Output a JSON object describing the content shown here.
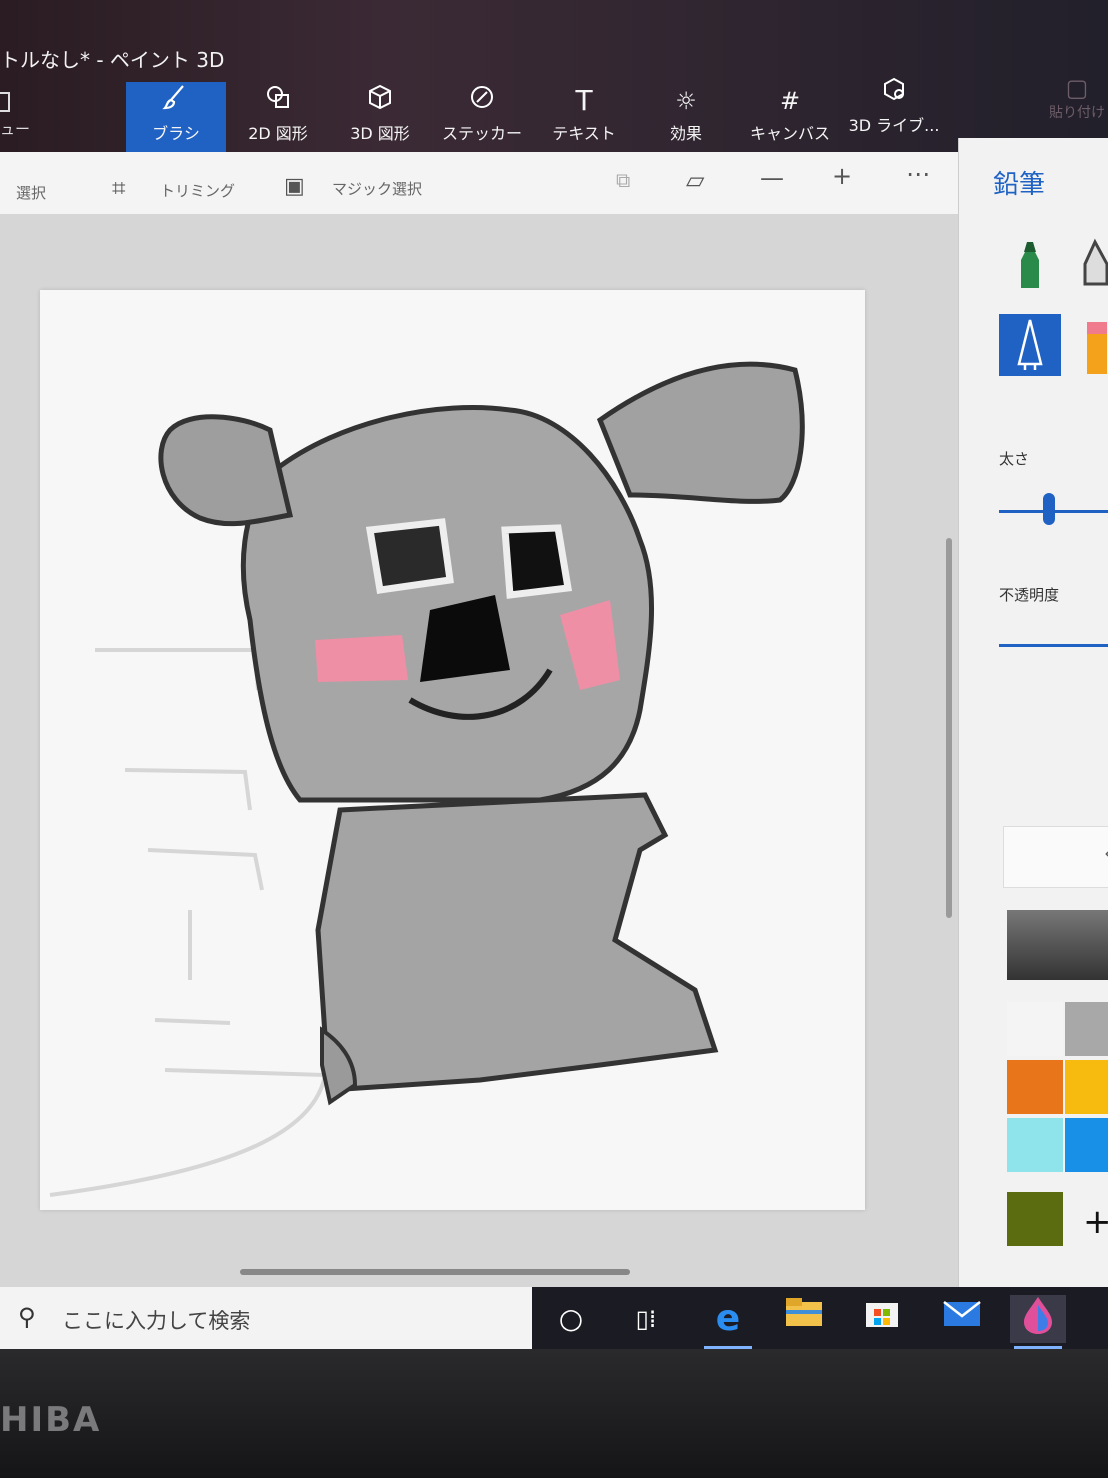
{
  "window": {
    "title": "トルなし* - ペイント 3D",
    "menu_label": "ュー"
  },
  "ribbon": {
    "items": [
      {
        "label": "ブラシ",
        "icon": "brush-icon"
      },
      {
        "label": "2D 図形",
        "icon": "2d-shapes-icon"
      },
      {
        "label": "3D 図形",
        "icon": "3d-shapes-icon"
      },
      {
        "label": "ステッカー",
        "icon": "stickers-icon"
      },
      {
        "label": "テキスト",
        "icon": "text-icon"
      },
      {
        "label": "効果",
        "icon": "effects-icon"
      },
      {
        "label": "キャンバス",
        "icon": "canvas-icon"
      },
      {
        "label": "3D ライブ...",
        "icon": "3d-library-icon"
      }
    ],
    "paste_label": "貼り付け"
  },
  "toolbar": {
    "select_label": "選択",
    "crop_label": "トリミング",
    "magic_select_label": "マジック選択"
  },
  "panel": {
    "title": "鉛筆",
    "thickness_label": "太さ",
    "thickness_value": 0.45,
    "opacity_label": "不透明度",
    "opacity_value": 1.0,
    "colors": [
      "#f4f4f4",
      "#a8a8a8",
      "#e8751a",
      "#f7bb10",
      "#8fe3ea",
      "#1890e8",
      "#5b6b10"
    ]
  },
  "taskbar": {
    "search_placeholder": "ここに入力して検索",
    "apps": [
      "cortana-icon",
      "task-view-icon",
      "edge-icon",
      "file-explorer-icon",
      "store-icon",
      "mail-icon",
      "paint3d-icon"
    ]
  },
  "bezel": {
    "brand": "HIBA"
  },
  "colors": {
    "accent": "#1f62c4",
    "taskbar": "#1b1b24"
  }
}
